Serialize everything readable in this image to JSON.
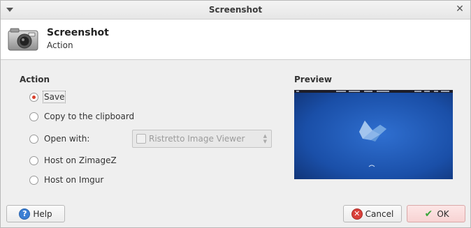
{
  "window": {
    "title": "Screenshot"
  },
  "header": {
    "title": "Screenshot",
    "subtitle": "Action",
    "icon": "camera-icon"
  },
  "action": {
    "title": "Action",
    "options": [
      {
        "label": "Save",
        "checked": true
      },
      {
        "label": "Copy to the clipboard",
        "checked": false
      },
      {
        "label": "Open with:",
        "checked": false
      },
      {
        "label": "Host on ZimageZ",
        "checked": false
      },
      {
        "label": "Host on Imgur",
        "checked": false
      }
    ],
    "open_with_app": "Ristretto Image Viewer"
  },
  "preview": {
    "title": "Preview"
  },
  "buttons": {
    "help": "Help",
    "cancel": "Cancel",
    "ok": "OK"
  },
  "colors": {
    "accent_radio": "#d9402c",
    "ok_bg": "#f7d3d3",
    "preview_blue": "#1a4fa8"
  }
}
